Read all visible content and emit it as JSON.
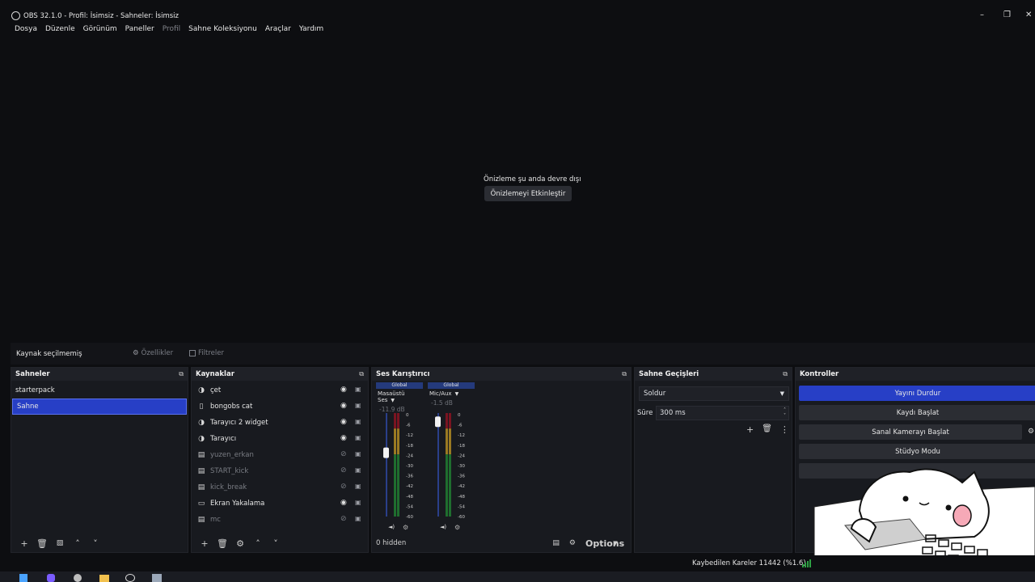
{
  "window": {
    "title": "OBS 32.1.0 - Profil: İsimsiz - Sahneler: İsimsiz"
  },
  "menu": [
    "Dosya",
    "Düzenle",
    "Görünüm",
    "Paneller",
    "Profil",
    "Sahne Koleksiyonu",
    "Araçlar",
    "Yardım"
  ],
  "preview": {
    "message": "Önizleme şu anda devre dışı",
    "enable_button": "Önizlemeyi Etkinleştir"
  },
  "source_bar": {
    "no_source": "Kaynak seçilmemiş",
    "properties": "Özellikler",
    "filters": "Filtreler"
  },
  "scenes": {
    "title": "Sahneler",
    "items": [
      "starterpack",
      "Sahne"
    ],
    "selected": "Sahne"
  },
  "sources": {
    "title": "Kaynaklar",
    "items": [
      {
        "name": "çet",
        "icon": "browser-icon",
        "visible": true
      },
      {
        "name": "bongobs cat",
        "icon": "file-icon",
        "visible": true
      },
      {
        "name": "Tarayıcı 2 widget",
        "icon": "browser-icon",
        "visible": true
      },
      {
        "name": "Tarayıcı",
        "icon": "browser-icon",
        "visible": true
      },
      {
        "name": "yuzen_erkan",
        "icon": "media-icon",
        "visible": false
      },
      {
        "name": "START_kick",
        "icon": "media-icon",
        "visible": false
      },
      {
        "name": "kick_break",
        "icon": "media-icon",
        "visible": false
      },
      {
        "name": "Ekran Yakalama",
        "icon": "monitor-icon",
        "visible": true
      },
      {
        "name": "mc",
        "icon": "media-icon",
        "visible": false
      }
    ]
  },
  "mixer": {
    "title": "Ses Karıştırıcı",
    "channels": [
      {
        "global": "Global",
        "name": "Masaüstü Ses",
        "db": "-11.9 dB",
        "level": 0.62
      },
      {
        "global": "Global",
        "name": "Mic/Aux",
        "db": "-1.5 dB",
        "level": 0.92
      }
    ],
    "scale": [
      "0",
      "-6",
      "-12",
      "-18",
      "-24",
      "-30",
      "-36",
      "-42",
      "-48",
      "-54",
      "-60"
    ],
    "hidden_count": "0 hidden",
    "options": "Options"
  },
  "transitions": {
    "title": "Sahne Geçişleri",
    "selected": "Soldur",
    "duration_label": "Süre",
    "duration_value": "300 ms"
  },
  "controls": {
    "title": "Kontroller",
    "stop_stream": "Yayını Durdur",
    "start_record": "Kaydı Başlat",
    "start_vcam": "Sanal Kamerayı Başlat",
    "studio_mode": "Stüdyo Modu"
  },
  "status": {
    "dropped_frames": "Kaybedilen Kareler 11442 (%1.6)"
  },
  "colors": {
    "accent": "#273fc6",
    "background": "#0d0e11",
    "panel": "#181a1f"
  }
}
